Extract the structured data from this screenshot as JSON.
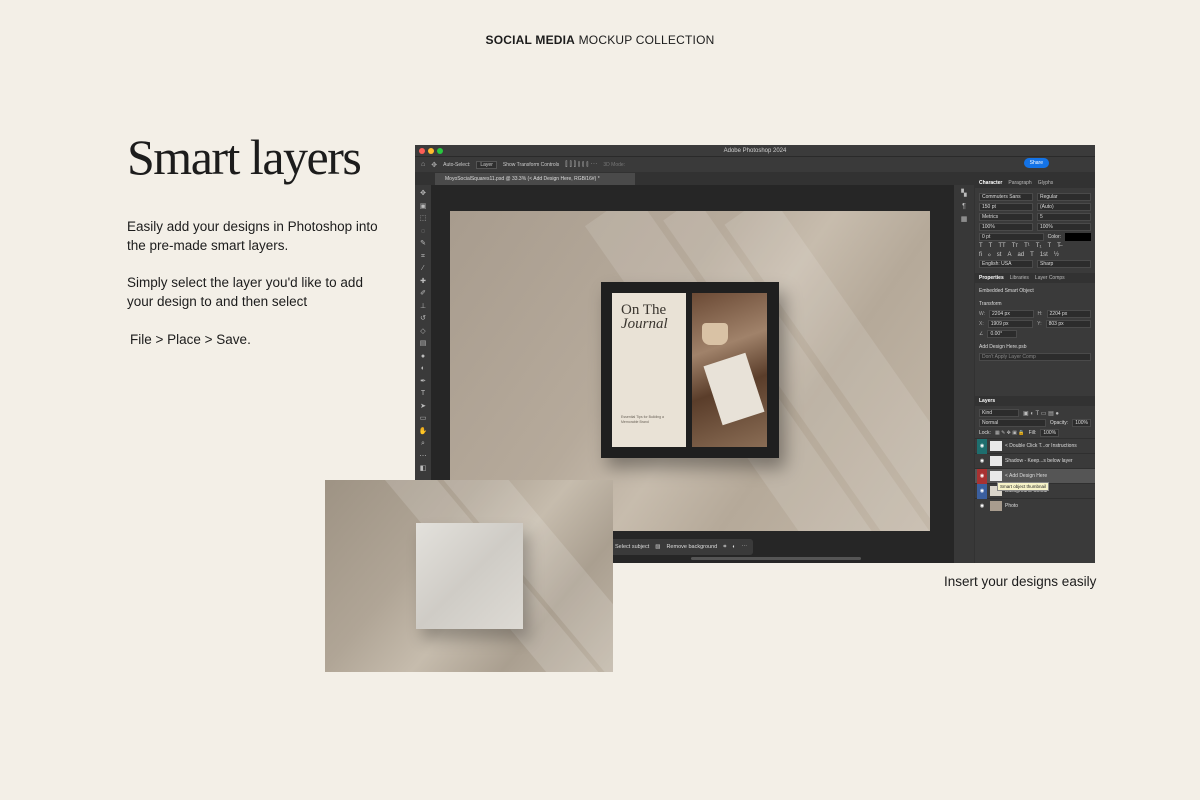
{
  "header": {
    "bold": "SOCIAL MEDIA",
    "rest": " MOCKUP COLLECTION"
  },
  "title": "Smart layers",
  "paragraphs": {
    "p1": "Easily add your designs in Photoshop into the pre-made smart layers.",
    "p2": "Simply select the layer you'd like to add your design to and then select",
    "p3": "File > Place > Save."
  },
  "caption": "Insert your designs easily",
  "ps": {
    "window_title": "Adobe Photoshop 2024",
    "options": {
      "auto_select": "Auto-Select:",
      "layer_dropdown": "Layer",
      "show_transform": "Show Transform Controls",
      "mode_3d": "3D Mode:"
    },
    "share": "Share",
    "doc_tab": "MoyoSocialSquares11.psd @ 33.3% (< Add Design Here, RGB/16#) *",
    "artwork": {
      "title_line1": "On The",
      "title_line2": "Journal",
      "subtitle": "Essential Tips for Building a Memorable Brand"
    },
    "context_bar": {
      "select_subject": "Select subject",
      "remove_background": "Remove background"
    },
    "character": {
      "tabs": [
        "Character",
        "Paragraph",
        "Glyphs"
      ],
      "font": "Commuters Sans",
      "style": "Regular",
      "size": "150 pt",
      "leading": "(Auto)",
      "kerning": "Metrics",
      "tracking": "5",
      "vscale": "100%",
      "hscale": "100%",
      "baseline": "0 pt",
      "color_label": "Color:",
      "language": "English: USA",
      "aa": "Sharp"
    },
    "properties": {
      "tabs": [
        "Properties",
        "Libraries",
        "Layer Comps"
      ],
      "kind": "Embedded Smart Object",
      "transform": "Transform",
      "w": "2204 px",
      "h": "2204 px",
      "x": "1909 px",
      "y": "803 px",
      "angle": "0.00°",
      "file": "Add Design Here.psb",
      "comp": "Don't Apply Layer Comp"
    },
    "layers": {
      "tab": "Layers",
      "filter": "Kind",
      "blend": "Normal",
      "opacity_label": "Opacity:",
      "opacity": "100%",
      "lock_label": "Lock:",
      "fill_label": "Fill:",
      "fill": "100%",
      "items": [
        "< Double Click T...or Instructions",
        "Shadow - Keep...s below layer",
        "< Add Design Here",
        "Background Colour",
        "Photo"
      ],
      "tooltip": "Smart object thumbnail"
    }
  },
  "colors": {
    "bg": "#f3efe7",
    "accent": "#1473e6"
  }
}
